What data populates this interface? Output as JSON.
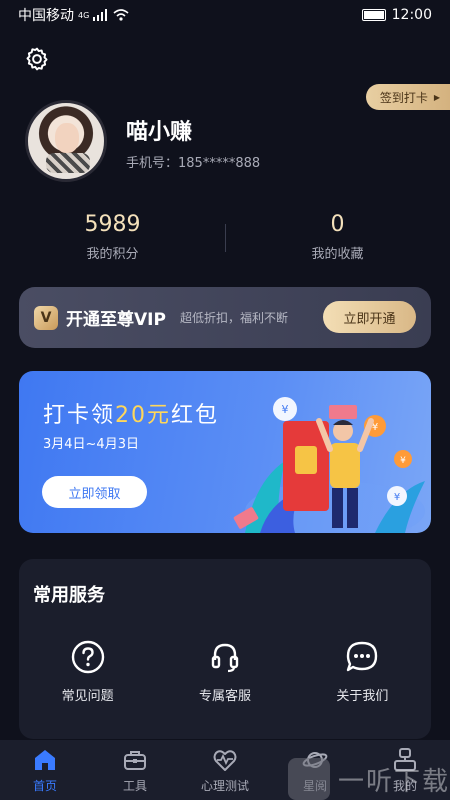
{
  "status": {
    "carrier": "中国移动",
    "network": "4G",
    "time": "12:00"
  },
  "header": {
    "checkin_label": "签到打卡"
  },
  "profile": {
    "name": "喵小赚",
    "phone": "手机号：185*****888"
  },
  "stats": [
    {
      "value": "5989",
      "label": "我的积分"
    },
    {
      "value": "0",
      "label": "我的收藏"
    }
  ],
  "vip": {
    "title": "开通至尊VIP",
    "subtitle": "超低折扣，福利不断",
    "button": "立即开通",
    "logo_char": "V"
  },
  "banner": {
    "title_prefix": "打卡领",
    "title_amount": "20元",
    "title_suffix": "红包",
    "date_range": "3月4日~4月3日",
    "button": "立即领取"
  },
  "services": {
    "title": "常用服务",
    "items": [
      {
        "icon": "question-circle-icon",
        "label": "常见问题"
      },
      {
        "icon": "headset-icon",
        "label": "专属客服"
      },
      {
        "icon": "chat-bubble-icon",
        "label": "关于我们"
      }
    ]
  },
  "tabbar": {
    "items": [
      {
        "icon": "home-icon",
        "label": "首页",
        "active": true
      },
      {
        "icon": "toolbox-icon",
        "label": "工具",
        "active": false
      },
      {
        "icon": "heart-pulse-icon",
        "label": "心理测试",
        "active": false
      },
      {
        "icon": "planet-icon",
        "label": "星阅",
        "active": false
      },
      {
        "icon": "profile-icon",
        "label": "我的",
        "active": false
      }
    ]
  },
  "watermark": {
    "text": "一听下载"
  },
  "colors": {
    "accent": "#3a7bff",
    "gold": "#f4e1bb",
    "background": "#0f111c",
    "card": "#1b1e2c"
  }
}
